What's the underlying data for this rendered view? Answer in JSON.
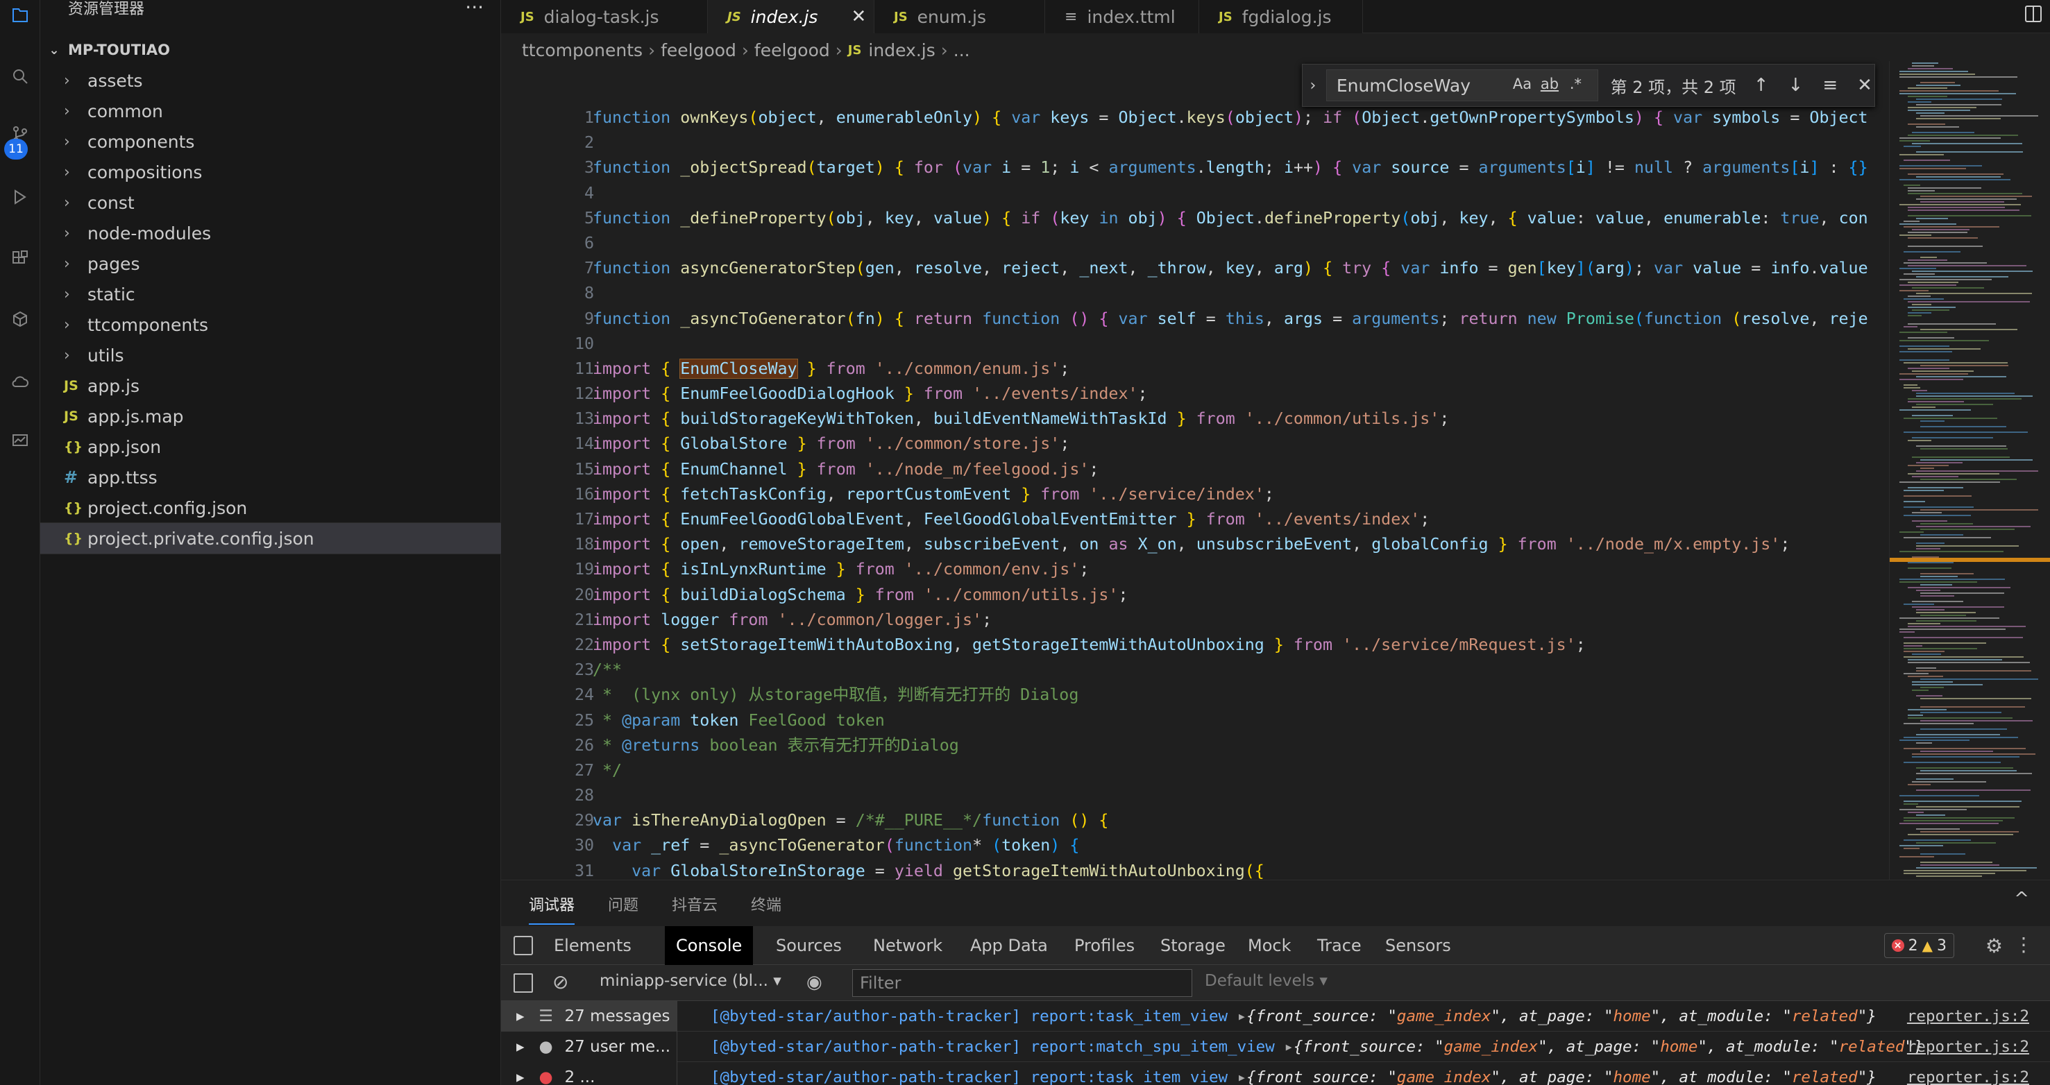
{
  "activity": {
    "scm_badge": "11",
    "icons": [
      "explorer-icon",
      "search-icon",
      "source-control-icon",
      "run-debug-icon",
      "extensions-icon",
      "package-icon",
      "cloud-icon",
      "monitor-icon"
    ]
  },
  "sidebar": {
    "title": "资源管理器",
    "more": "···",
    "root": "MP-TOUTIAO",
    "items": [
      {
        "label": "assets",
        "type": "folder"
      },
      {
        "label": "common",
        "type": "folder"
      },
      {
        "label": "components",
        "type": "folder"
      },
      {
        "label": "compositions",
        "type": "folder"
      },
      {
        "label": "const",
        "type": "folder"
      },
      {
        "label": "node-modules",
        "type": "folder"
      },
      {
        "label": "pages",
        "type": "folder"
      },
      {
        "label": "static",
        "type": "folder"
      },
      {
        "label": "ttcomponents",
        "type": "folder"
      },
      {
        "label": "utils",
        "type": "folder"
      },
      {
        "label": "app.js",
        "type": "js",
        "icon": "JS"
      },
      {
        "label": "app.js.map",
        "type": "js",
        "icon": "JS"
      },
      {
        "label": "app.json",
        "type": "json",
        "icon": "{}"
      },
      {
        "label": "app.ttss",
        "type": "ttss",
        "icon": "#"
      },
      {
        "label": "project.config.json",
        "type": "json",
        "icon": "{}"
      },
      {
        "label": "project.private.config.json",
        "type": "json",
        "icon": "{}",
        "selected": true
      }
    ]
  },
  "tabs": [
    {
      "label": "dialog-task.js",
      "icon": "JS"
    },
    {
      "label": "index.js",
      "icon": "JS",
      "active": true,
      "close": "✕"
    },
    {
      "label": "enum.js",
      "icon": "JS"
    },
    {
      "label": "index.ttml",
      "icon": "≡"
    },
    {
      "label": "fgdialog.js",
      "icon": "JS"
    }
  ],
  "breadcrumb": {
    "parts": [
      "ttcomponents",
      "feelgood",
      "feelgood"
    ],
    "file_icon": "JS",
    "file": "index.js",
    "tail": "..."
  },
  "find": {
    "query": "EnumCloseWay",
    "opt_case": "Aa",
    "opt_word": "ab",
    "opt_regex": ".*",
    "count": "第 2 项，共 2 项"
  },
  "code": {
    "line_numbers": [
      "1",
      "2",
      "3",
      "4",
      "5",
      "6",
      "7",
      "8",
      "9",
      "10",
      "11",
      "12",
      "13",
      "14",
      "15",
      "16",
      "17",
      "18",
      "19",
      "20",
      "21",
      "22",
      "23",
      "24",
      "25",
      "26",
      "27",
      "28",
      "29",
      "30",
      "31"
    ]
  },
  "panel": {
    "tabs": [
      "调试器",
      "问题",
      "抖音云",
      "终端"
    ],
    "collapse": "^"
  },
  "devtools": {
    "tabs": [
      "Elements",
      "Console",
      "Sources",
      "Network",
      "App Data",
      "Profiles",
      "Storage",
      "Mock",
      "Trace",
      "Sensors"
    ],
    "errors": "2",
    "warnings": "3"
  },
  "console": {
    "context": "miniapp-service (bl...",
    "filter_placeholder": "Filter",
    "levels": "Default levels",
    "sidebar": [
      {
        "label": "27 messages"
      },
      {
        "label": "27 user me..."
      },
      {
        "label": "2 ..."
      }
    ],
    "rows": [
      {
        "tag": "[@byted-star/author-path-tracker]",
        "event": "report:task_item_view",
        "obj": {
          "front_source": "game_index",
          "at_page": "home",
          "at_module": "related"
        },
        "source": "reporter.js:2"
      },
      {
        "tag": "[@byted-star/author-path-tracker]",
        "event": "report:match_spu_item_view",
        "obj": {
          "front_source": "game_index",
          "at_page": "home",
          "at_module": "related"
        },
        "source": "reporter.js:2"
      },
      {
        "tag": "[@byted-star/author-path-tracker]",
        "event": "report:task_item_view",
        "obj": {
          "front_source": "game_index",
          "at_page": "home",
          "at_module": "related"
        },
        "source": "reporter.js:2"
      }
    ]
  }
}
